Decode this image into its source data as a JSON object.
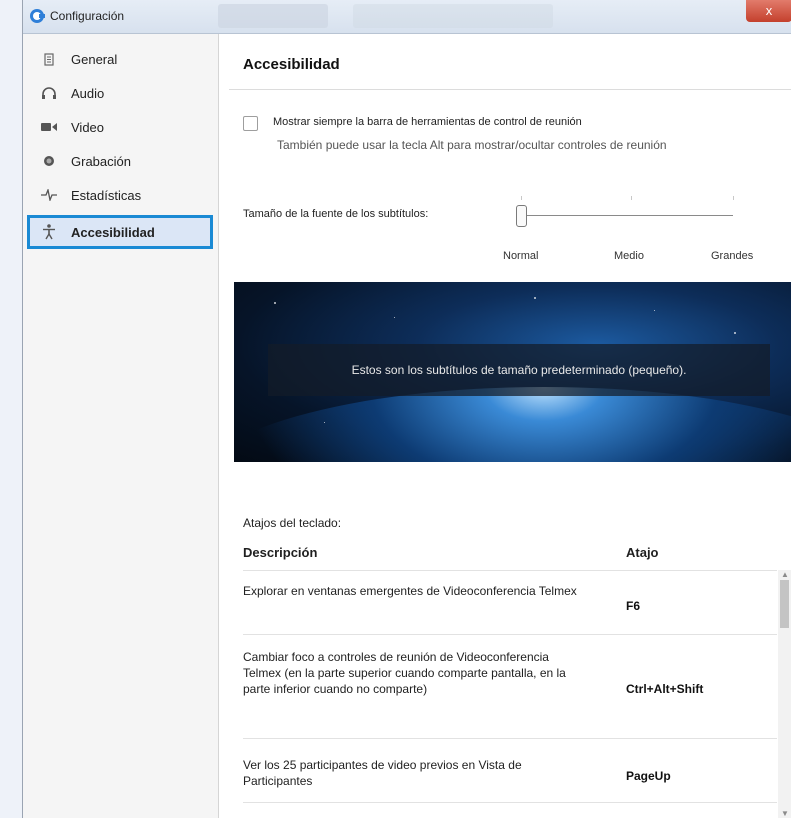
{
  "window": {
    "title": "Configuración",
    "close_glyph": "x"
  },
  "sidebar": {
    "items": [
      {
        "label": "General",
        "icon": "document-icon",
        "active": false
      },
      {
        "label": "Audio",
        "icon": "headphones-icon",
        "active": false
      },
      {
        "label": "Video",
        "icon": "video-camera-icon",
        "active": false
      },
      {
        "label": "Grabación",
        "icon": "record-icon",
        "active": false
      },
      {
        "label": "Estadísticas",
        "icon": "pulse-icon",
        "active": false
      },
      {
        "label": "Accesibilidad",
        "icon": "accessibility-icon",
        "active": true
      }
    ],
    "highlight_color": "#1a8ad4"
  },
  "main": {
    "title": "Accesibilidad",
    "toolbar_checkbox": {
      "label": "Mostrar siempre la barra de herramientas de control de reunión",
      "hint": "También puede usar la tecla Alt para mostrar/ocultar controles de reunión",
      "checked": false
    },
    "subtitle_size": {
      "label": "Tamaño de la fuente de los subtítulos:",
      "options": [
        "Normal",
        "Medio",
        "Grandes"
      ],
      "selected": "Normal"
    },
    "preview": {
      "caption": "Estos son los subtítulos de tamaño predeterminado (pequeño)."
    },
    "shortcuts": {
      "title": "Atajos del teclado:",
      "columns": [
        "Descripción",
        "Atajo"
      ],
      "rows": [
        {
          "description": "Explorar en ventanas emergentes de Videoconferencia Telmex",
          "shortcut": "F6"
        },
        {
          "description": "Cambiar foco a controles de reunión de Videoconferencia Telmex (en la parte superior cuando comparte pantalla, en la parte inferior cuando no comparte)",
          "shortcut": "Ctrl+Alt+Shift"
        },
        {
          "description": "Ver los 25 participantes de video previos en Vista de Participantes",
          "shortcut": "PageUp"
        }
      ]
    }
  }
}
